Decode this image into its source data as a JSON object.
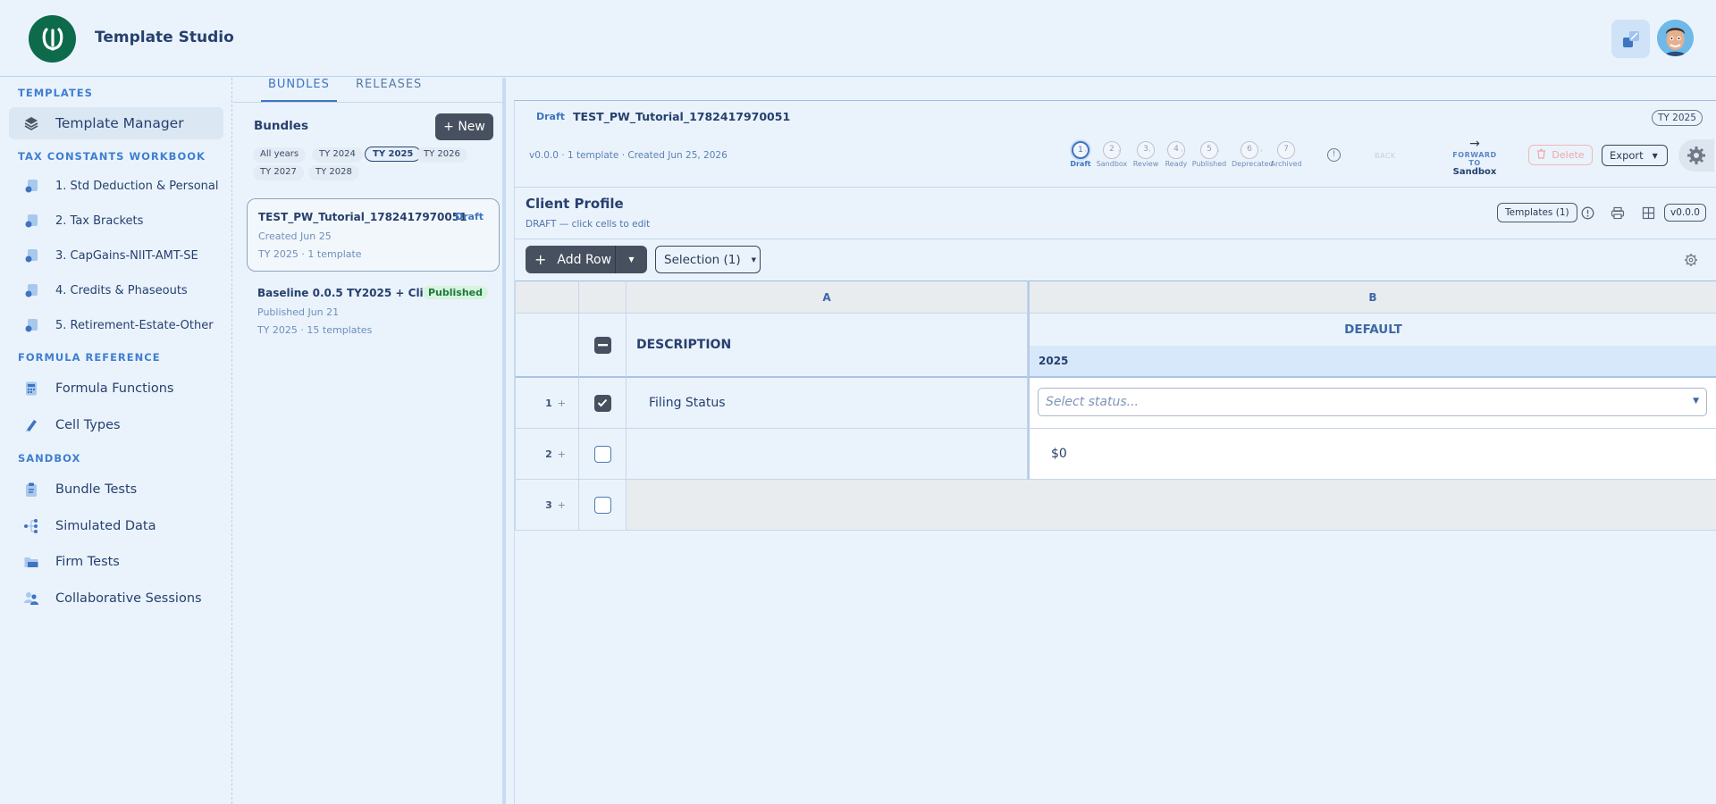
{
  "app": {
    "title": "Template Studio"
  },
  "sidebar": {
    "sections": [
      {
        "label": "TEMPLATES"
      },
      {
        "label": "TAX CONSTANTS WORKBOOK"
      },
      {
        "label": "FORMULA REFERENCE"
      },
      {
        "label": "SANDBOX"
      }
    ],
    "items": [
      {
        "label": "Template Manager",
        "icon": "layers-icon"
      },
      {
        "label": "1. Std Deduction & Personal",
        "icon": "workbook-icon"
      },
      {
        "label": "2. Tax Brackets",
        "icon": "workbook-icon"
      },
      {
        "label": "3. CapGains-NIIT-AMT-SE",
        "icon": "workbook-icon"
      },
      {
        "label": "4. Credits & Phaseouts",
        "icon": "workbook-icon"
      },
      {
        "label": "5. Retirement-Estate-Other",
        "icon": "workbook-icon"
      },
      {
        "label": "Formula Functions",
        "icon": "calculator-icon"
      },
      {
        "label": "Cell Types",
        "icon": "pen-icon"
      },
      {
        "label": "Bundle Tests",
        "icon": "clipboard-icon"
      },
      {
        "label": "Simulated Data",
        "icon": "hierarchy-icon"
      },
      {
        "label": "Firm Tests",
        "icon": "folder-icon"
      },
      {
        "label": "Collaborative Sessions",
        "icon": "users-icon"
      }
    ]
  },
  "bundles_panel": {
    "tabs": [
      "BUNDLES",
      "RELEASES"
    ],
    "heading": "Bundles",
    "new_label": "+ New",
    "filters": [
      "All years",
      "TY 2024",
      "TY 2025",
      "TY 2026",
      "TY 2027",
      "TY 2028"
    ],
    "selected_filter": "TY 2025",
    "cards": [
      {
        "title": "TEST_PW_Tutorial_1782417970051",
        "badge": "Draft",
        "line1": "Created Jun 25",
        "line2": "TY 2025 · 1 template"
      },
      {
        "title": "Baseline 0.0.5 TY2025 + Clie...",
        "badge": "Published",
        "line1": "Published Jun 21",
        "line2": "TY 2025 · 15 templates"
      }
    ]
  },
  "bundle_header": {
    "status": "Draft",
    "name": "TEST_PW_Tutorial_1782417970051",
    "tax_year": "TY 2025",
    "meta": "v0.0.0 · 1 template · Created Jun 25, 2026",
    "steps": [
      {
        "num": "1",
        "label": "Draft"
      },
      {
        "num": "2",
        "label": "Sandbox"
      },
      {
        "num": "3",
        "label": "Review"
      },
      {
        "num": "4",
        "label": "Ready"
      },
      {
        "num": "5",
        "label": "Published"
      },
      {
        "num": "6",
        "label": "Deprecated"
      },
      {
        "num": "7",
        "label": "Archived"
      }
    ],
    "current_step": 1,
    "info_label": "!",
    "back_label": "BACK",
    "forward_label": "FORWARD TO",
    "forward_target": "Sandbox",
    "delete_label": "Delete",
    "export_label": "Export"
  },
  "sheet": {
    "title": "Client Profile",
    "subtitle": "DRAFT — click cells to edit",
    "templates_label": "Templates (1)",
    "version_label": "v0.0.0",
    "add_row_label": "Add Row",
    "selection_label": "Selection (1)",
    "columns": [
      "A",
      "B"
    ],
    "description_header": "DESCRIPTION",
    "default_header": "DEFAULT",
    "year_header": "2025",
    "rows": [
      {
        "num": "1",
        "checked": true,
        "description": "Filing Status",
        "value": "",
        "placeholder": "Select status..."
      },
      {
        "num": "2",
        "checked": false,
        "description": "",
        "value": "$0"
      },
      {
        "num": "3",
        "checked": false,
        "description": "",
        "value": ""
      }
    ],
    "plus": "+"
  },
  "colors": {
    "accent": "#3e74c0",
    "dark_button": "#46505e",
    "brand_green": "#0d6a4a",
    "published_bg": "#d6f3de",
    "published_text": "#1c7a3c"
  }
}
